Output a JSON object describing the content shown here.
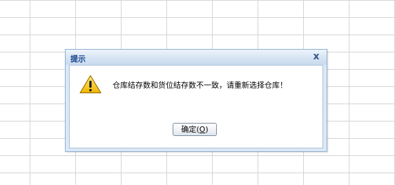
{
  "dialog": {
    "title": "提示",
    "close_label": "x",
    "message": "仓库结存数和货位结存数不一致，请重新选择仓库！",
    "icon": "warning-icon",
    "ok_button": {
      "label": "确定(",
      "accel": "O",
      "suffix": ")"
    }
  },
  "colors": {
    "title_text": "#15428b",
    "dialog_frame": "#dce8f5",
    "grid_line": "#d4d4d4",
    "warning_yellow": "#f5c400"
  }
}
